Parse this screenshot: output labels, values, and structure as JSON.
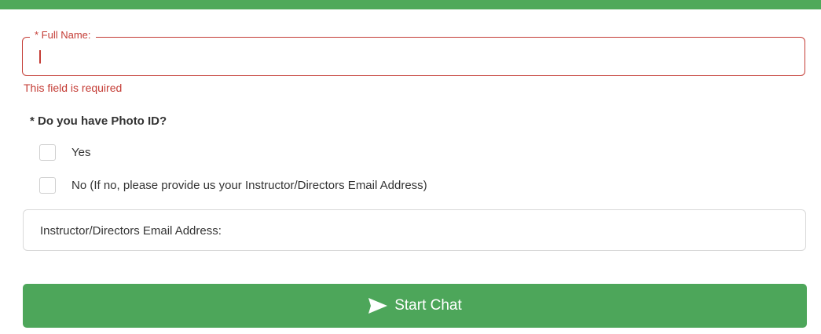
{
  "colors": {
    "accent_green": "#4da65a",
    "error_red": "#c43c35",
    "border_gray": "#d9d9d9"
  },
  "form": {
    "full_name": {
      "label": "* Full Name:",
      "value": "",
      "error": "This field is required"
    },
    "photo_id": {
      "question": "* Do you have Photo ID?",
      "options": [
        {
          "label": "Yes",
          "checked": false
        },
        {
          "label": "No (If no, please provide us your Instructor/Directors Email Address)",
          "checked": false
        }
      ]
    },
    "instructor_email": {
      "placeholder": "Instructor/Directors Email Address:",
      "value": ""
    },
    "submit": {
      "icon": "send-icon",
      "label": "Start Chat"
    }
  }
}
